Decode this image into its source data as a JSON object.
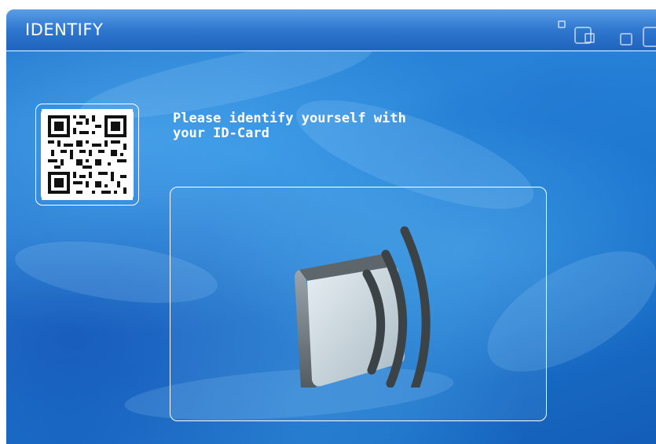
{
  "window": {
    "title": "IDENTIFY",
    "controls": [
      "window-small-icon",
      "window-tiles-icon",
      "window-restore-icon",
      "window-large-icon"
    ]
  },
  "qr": {
    "icon": "qr-code-icon"
  },
  "instruction": {
    "line1": "Please identify yourself with",
    "line2": "your ID-Card"
  },
  "reader": {
    "icon": "contactless-card-icon"
  },
  "colors": {
    "background": "#1f7ad3",
    "header": "#2f77cf",
    "text": "#ffffff"
  }
}
